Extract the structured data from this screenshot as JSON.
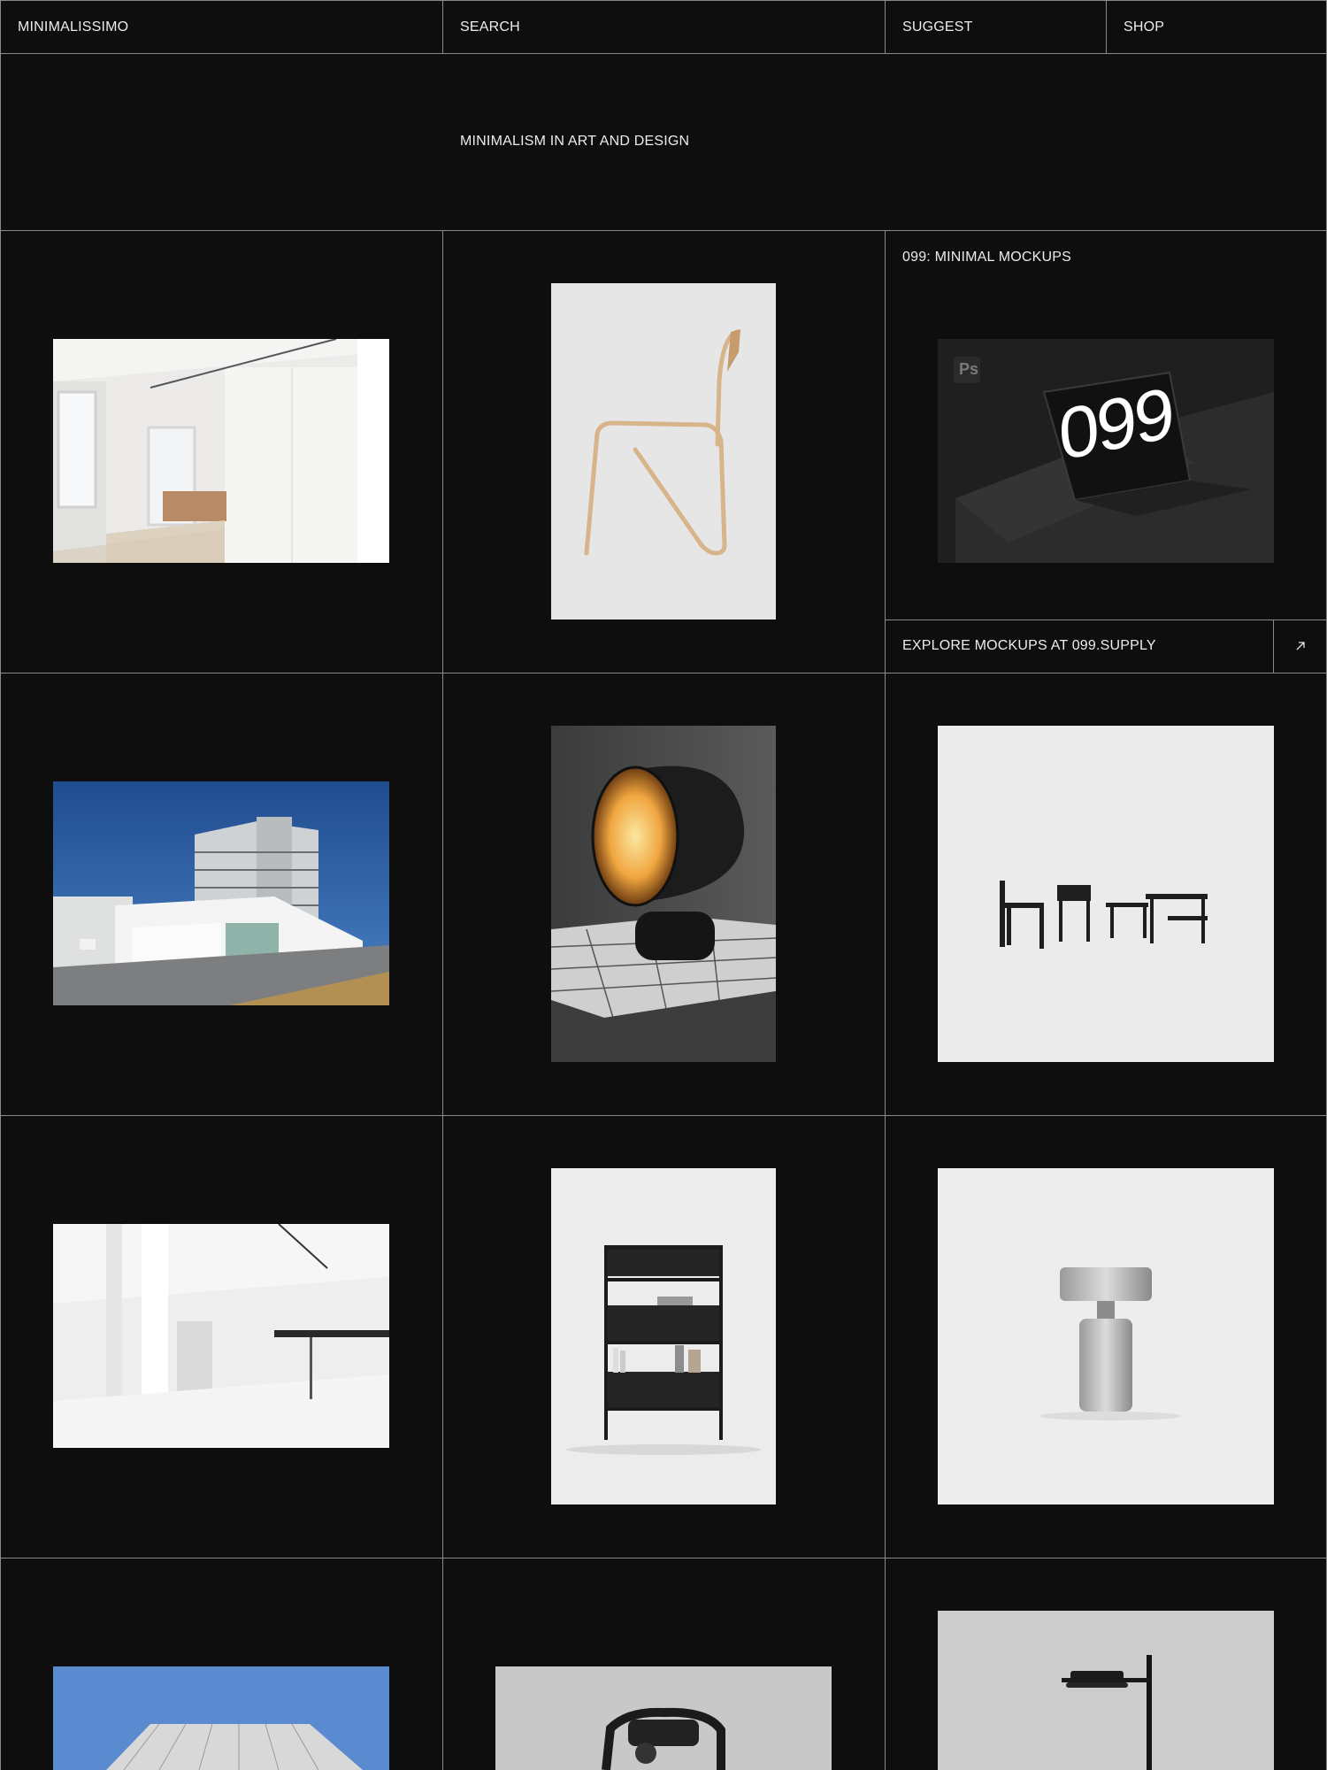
{
  "nav": {
    "brand": "MINIMALISSIMO",
    "search": "SEARCH",
    "suggest": "SUGGEST",
    "shop": "SHOP"
  },
  "hero": {
    "tagline": "MINIMALISM IN ART AND DESIGN"
  },
  "promo": {
    "title": "099: MINIMAL MOCKUPS",
    "cta": "EXPLORE MOCKUPS AT 099.SUPPLY",
    "arrow_icon": "arrow-up-right-icon",
    "laptop_screen_text": "099",
    "badge_text": "Ps"
  },
  "grid": {
    "items": [
      {
        "icon": "interior-room-photo"
      },
      {
        "icon": "bent-wood-chair-photo"
      },
      {
        "icon": "laptop-mockup-photo"
      },
      {
        "icon": "white-house-architecture-photo"
      },
      {
        "icon": "glowing-lamp-photo"
      },
      {
        "icon": "chairs-and-table-photo"
      },
      {
        "icon": "white-gallery-interior-photo"
      },
      {
        "icon": "black-shelf-photo"
      },
      {
        "icon": "metal-table-lamp-photo"
      },
      {
        "icon": "roof-sky-photo"
      },
      {
        "icon": "black-chair-photo"
      },
      {
        "icon": "floor-lamp-photo"
      }
    ]
  },
  "colors": {
    "background": "#0e0e0e",
    "grid_line": "#8a8a8a",
    "text": "#ececec"
  }
}
